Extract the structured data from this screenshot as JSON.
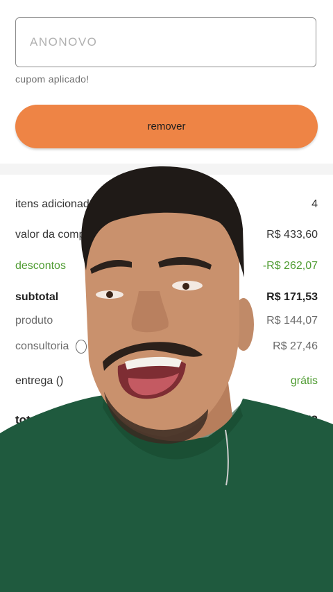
{
  "coupon": {
    "code": "ANONOVO",
    "status": "cupom aplicado!",
    "remove_label": "remover"
  },
  "summary": {
    "items_added": {
      "label": "itens adicionados",
      "value": "4"
    },
    "purchase_value": {
      "label": "valor da compra",
      "value": "R$ 433,60"
    },
    "discounts": {
      "label": "descontos",
      "value": "-R$ 262,07"
    },
    "subtotal": {
      "label": "subtotal",
      "value": "R$ 171,53"
    },
    "product": {
      "label": "produto",
      "value": "R$ 144,07"
    },
    "consultancy": {
      "label": "consultoria",
      "value": "R$ 27,46"
    },
    "delivery": {
      "label": "entrega ()",
      "value": "grátis"
    },
    "total": {
      "label": "total",
      "value": "R$ 171,53"
    }
  },
  "colors": {
    "accent": "#ee8445",
    "green": "#4f9c32",
    "shirt": "#1f5a3e"
  }
}
